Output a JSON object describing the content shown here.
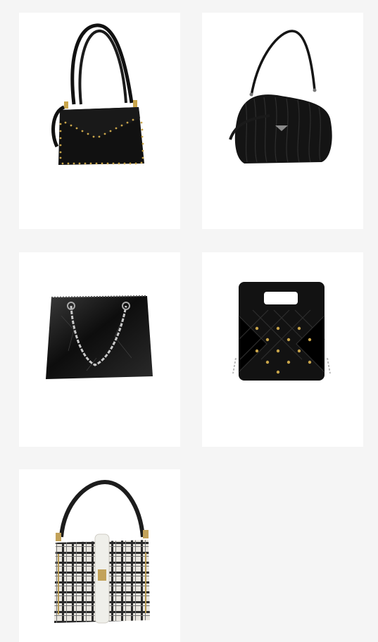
{
  "products": [
    {
      "id": "studded-shoulder-bag",
      "icon": "studded-handbag-image",
      "color": "#111111"
    },
    {
      "id": "ruched-hobo-bag",
      "icon": "hobo-bag-image",
      "color": "#141414"
    },
    {
      "id": "chain-crackle-bag",
      "icon": "chain-bag-image",
      "color": "#1a1a1a"
    },
    {
      "id": "quilted-cutout-tote",
      "icon": "quilted-tote-image",
      "color": "#121212"
    },
    {
      "id": "tweed-top-handle-bag",
      "icon": "tweed-bag-image",
      "color": "#e9e6df"
    }
  ]
}
